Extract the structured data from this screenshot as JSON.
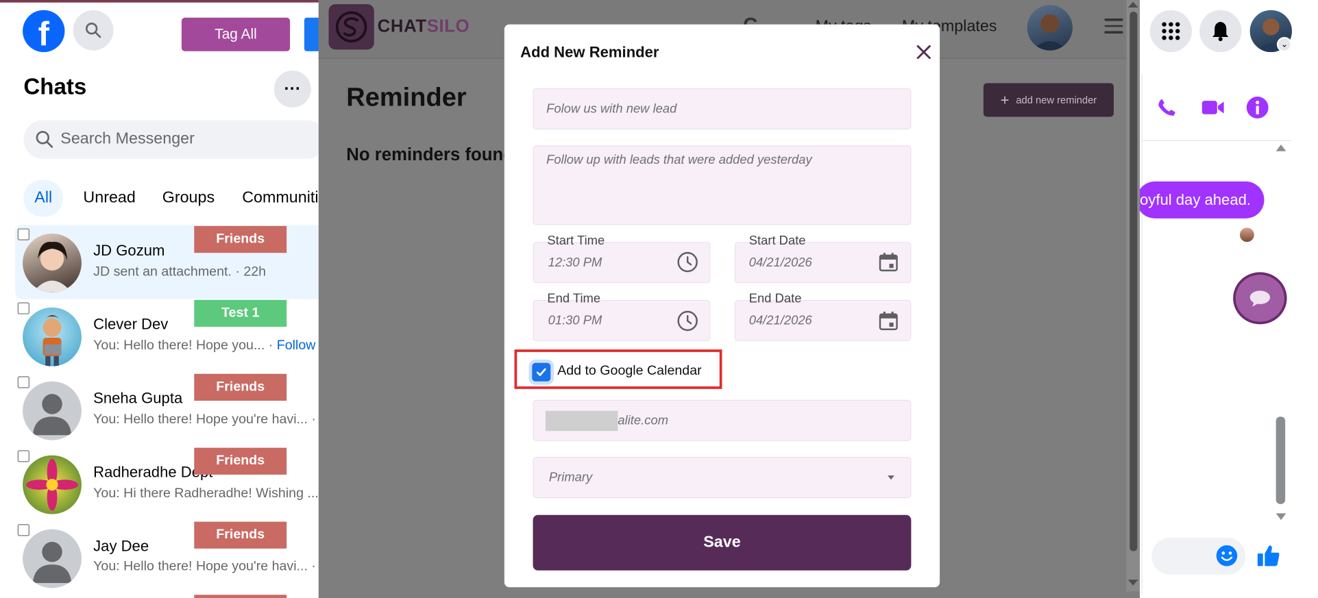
{
  "facebook": {
    "tag_all_label": "Tag All",
    "chats_title": "Chats",
    "search_placeholder": "Search Messenger",
    "filters": [
      "All",
      "Unread",
      "Groups",
      "Communiti"
    ],
    "chats": [
      {
        "name": "JD Gozum",
        "message": "JD sent an attachment. · 22h",
        "tag": "Friends",
        "tag_color": "#c96a63",
        "link": ""
      },
      {
        "name": "Clever Dev",
        "message": "You: Hello there! Hope you... · ",
        "tag": "Test 1",
        "tag_color": "#5cc97d",
        "link": "Follow u"
      },
      {
        "name": "Sneha Gupta",
        "message": "You: Hello there! Hope you're havi...  ·",
        "tag": "Friends",
        "tag_color": "#c96a63",
        "link": ""
      },
      {
        "name": "Radheradhe Dept",
        "message": "You: Hi there Radheradhe! Wishing ...  ·",
        "tag": "Friends",
        "tag_color": "#c96a63",
        "link": ""
      },
      {
        "name": "Jay Dee",
        "message": "You: Hello there! Hope you're havi...  ·",
        "tag": "Friends",
        "tag_color": "#c96a63",
        "link": ""
      }
    ],
    "conversation_bubble": "oyful day ahead.",
    "accent_color": "#a033ff"
  },
  "chatsilo": {
    "logo_part1": "CHAT",
    "logo_part2": "SILO",
    "nav_my_tags": "My tags",
    "nav_my_templates": "My templates",
    "page_title": "Reminder",
    "empty_text": "No reminders found",
    "add_button": "add new reminder"
  },
  "modal": {
    "title": "Add New Reminder",
    "title_placeholder": "Folow us with new lead",
    "description_placeholder": "Follow up with leads that were added yesterday",
    "start_time_label": "Start Time",
    "start_time_value": "12:30 PM",
    "start_date_label": "Start Date",
    "start_date_value": "04/21/2026",
    "end_time_label": "End Time",
    "end_time_value": "01:30 PM",
    "end_date_label": "End Date",
    "end_date_value": "04/21/2026",
    "google_calendar_label": "Add to Google Calendar",
    "google_calendar_checked": true,
    "email_visible_suffix": "alite.com",
    "calendar_select_value": "Primary",
    "save_label": "Save",
    "brand_color": "#572b58"
  }
}
